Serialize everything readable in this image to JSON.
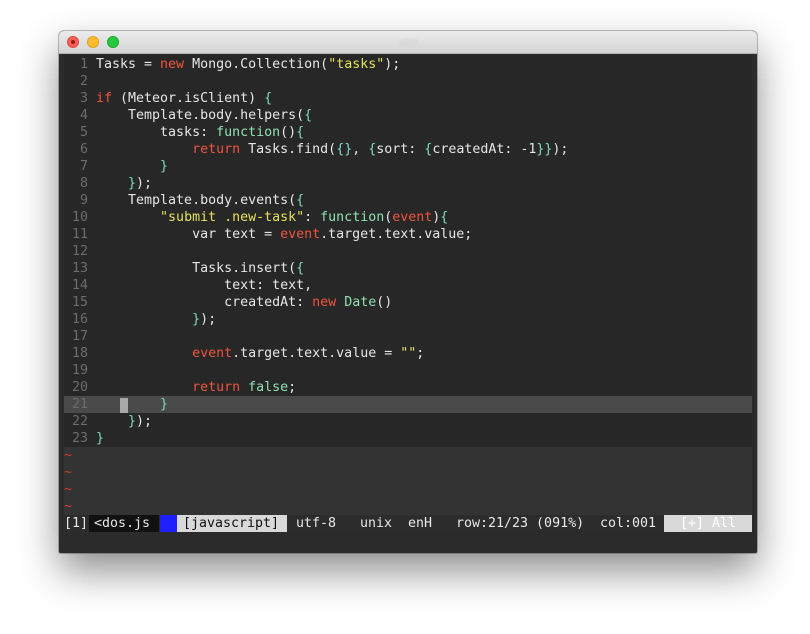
{
  "window": {
    "title": "vim"
  },
  "code_lines": [
    [
      {
        "t": "Tasks = ",
        "c": ""
      },
      {
        "t": "new",
        "c": "kw"
      },
      {
        "t": " Mongo.Collection(",
        "c": ""
      },
      {
        "t": "\"tasks\"",
        "c": "str"
      },
      {
        "t": ");",
        "c": ""
      }
    ],
    [],
    [
      {
        "t": "if",
        "c": "kw"
      },
      {
        "t": " (Meteor.isClient) ",
        "c": ""
      },
      {
        "t": "{",
        "c": "br"
      }
    ],
    [
      {
        "t": "    Template.body.helpers(",
        "c": ""
      },
      {
        "t": "{",
        "c": "br"
      }
    ],
    [
      {
        "t": "        tasks: ",
        "c": ""
      },
      {
        "t": "function",
        "c": "fn"
      },
      {
        "t": "()",
        "c": ""
      },
      {
        "t": "{",
        "c": "br"
      }
    ],
    [
      {
        "t": "            ",
        "c": ""
      },
      {
        "t": "return",
        "c": "kw"
      },
      {
        "t": " Tasks.find(",
        "c": ""
      },
      {
        "t": "{}",
        "c": "br"
      },
      {
        "t": ", ",
        "c": ""
      },
      {
        "t": "{",
        "c": "br"
      },
      {
        "t": "sort: ",
        "c": ""
      },
      {
        "t": "{",
        "c": "br"
      },
      {
        "t": "createdAt: -1",
        "c": ""
      },
      {
        "t": "}}",
        "c": "br"
      },
      {
        "t": ");",
        "c": ""
      }
    ],
    [
      {
        "t": "        ",
        "c": ""
      },
      {
        "t": "}",
        "c": "br"
      }
    ],
    [
      {
        "t": "    ",
        "c": ""
      },
      {
        "t": "}",
        "c": "br"
      },
      {
        "t": ");",
        "c": ""
      }
    ],
    [
      {
        "t": "    Template.body.events(",
        "c": ""
      },
      {
        "t": "{",
        "c": "br"
      }
    ],
    [
      {
        "t": "        ",
        "c": ""
      },
      {
        "t": "\"submit .new-task\"",
        "c": "str"
      },
      {
        "t": ": ",
        "c": ""
      },
      {
        "t": "function",
        "c": "fn"
      },
      {
        "t": "(",
        "c": ""
      },
      {
        "t": "event",
        "c": "var"
      },
      {
        "t": ")",
        "c": ""
      },
      {
        "t": "{",
        "c": "br"
      }
    ],
    [
      {
        "t": "            var text = ",
        "c": ""
      },
      {
        "t": "event",
        "c": "var"
      },
      {
        "t": ".target.text.value;",
        "c": ""
      }
    ],
    [],
    [
      {
        "t": "            Tasks.insert(",
        "c": ""
      },
      {
        "t": "{",
        "c": "br"
      }
    ],
    [
      {
        "t": "                text: text,",
        "c": ""
      }
    ],
    [
      {
        "t": "                createdAt: ",
        "c": ""
      },
      {
        "t": "new",
        "c": "kw"
      },
      {
        "t": " ",
        "c": ""
      },
      {
        "t": "Date",
        "c": "fn"
      },
      {
        "t": "()",
        "c": ""
      }
    ],
    [
      {
        "t": "            ",
        "c": ""
      },
      {
        "t": "}",
        "c": "br"
      },
      {
        "t": ");",
        "c": ""
      }
    ],
    [],
    [
      {
        "t": "            ",
        "c": ""
      },
      {
        "t": "event",
        "c": "var"
      },
      {
        "t": ".target.text.value = ",
        "c": ""
      },
      {
        "t": "\"\"",
        "c": "str"
      },
      {
        "t": ";",
        "c": ""
      }
    ],
    [],
    [
      {
        "t": "            ",
        "c": ""
      },
      {
        "t": "return",
        "c": "kw"
      },
      {
        "t": " ",
        "c": ""
      },
      {
        "t": "false",
        "c": "fn"
      },
      {
        "t": ";",
        "c": ""
      }
    ],
    [
      {
        "t": "        ",
        "c": ""
      },
      {
        "t": "}",
        "c": "br"
      }
    ],
    [
      {
        "t": "    ",
        "c": ""
      },
      {
        "t": "}",
        "c": "br"
      },
      {
        "t": ");",
        "c": ""
      }
    ],
    [
      {
        "t": "}",
        "c": "br"
      }
    ]
  ],
  "current_line": 21,
  "tilde_lines": [
    "~",
    "~",
    "~",
    "~"
  ],
  "statusline": {
    "buffer": "[1]",
    "file": "<dos.js",
    "filetype": "[javascript]",
    "encoding": "utf-8",
    "fileformat": "unix",
    "keymap": "enH",
    "row": "row:21/23 (091%)",
    "col": "col:001",
    "modified": "[+] All"
  },
  "colors": {
    "keyword": "#f0543c",
    "string": "#e5e05a",
    "function": "#8fe0b0",
    "bracket": "#7fd8c4",
    "tilde": "#d33b2c",
    "mode_indicator": "#2020ff"
  }
}
